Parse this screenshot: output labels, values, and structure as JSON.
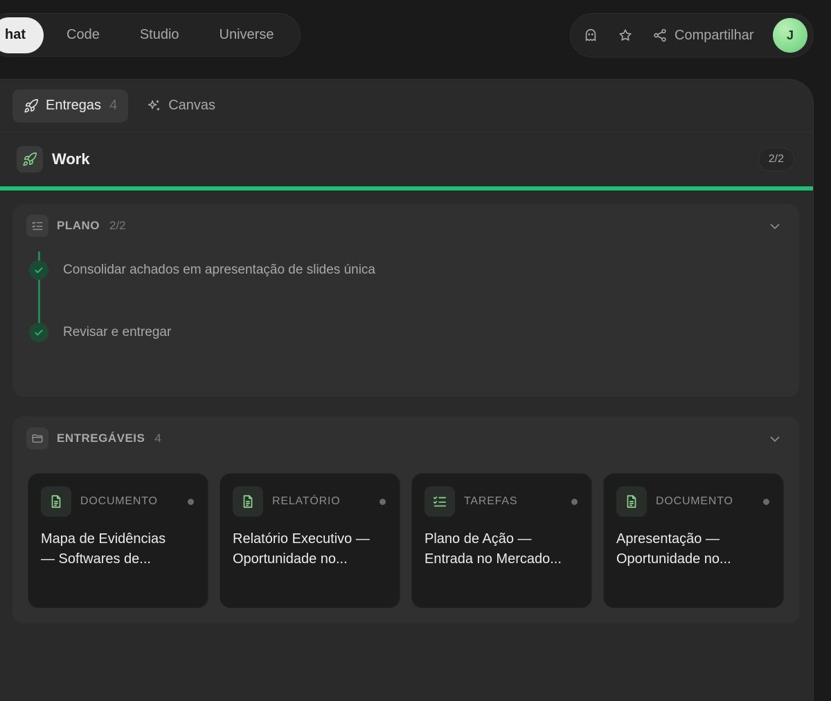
{
  "mode_tabs": [
    {
      "label": "hat",
      "active": true
    },
    {
      "label": "Code",
      "active": false
    },
    {
      "label": "Studio",
      "active": false
    },
    {
      "label": "Universe",
      "active": false
    }
  ],
  "top_actions": {
    "ghost_icon": "ghost-icon",
    "star_icon": "star-icon",
    "share_label": "Compartilhar",
    "avatar_initial": "J"
  },
  "panel_tabs": [
    {
      "label": "Entregas",
      "count": "4",
      "icon": "rocket-icon",
      "active": true
    },
    {
      "label": "Canvas",
      "count": "",
      "icon": "sparkles-icon",
      "active": false
    }
  ],
  "work": {
    "title": "Work",
    "count": "2/2",
    "progress": 1.0,
    "accent": "#22c073"
  },
  "plan": {
    "title": "PLANO",
    "count": "2/2",
    "steps": [
      {
        "text": "Consolidar achados em apresentação de slides única",
        "done": true
      },
      {
        "text": "Revisar e entregar",
        "done": true
      }
    ]
  },
  "deliverables": {
    "title": "ENTREGÁVEIS",
    "count": "4",
    "cards": [
      {
        "type": "DOCUMENTO",
        "icon": "document-icon",
        "title_line1": "Mapa de Evidências",
        "title_line2": "— Softwares de..."
      },
      {
        "type": "RELATÓRIO",
        "icon": "document-icon",
        "title_line1": "Relatório Executivo —",
        "title_line2": "Oportunidade no..."
      },
      {
        "type": "TAREFAS",
        "icon": "checklist-icon",
        "title_line1": "Plano de Ação —",
        "title_line2": "Entrada no Mercado..."
      },
      {
        "type": "DOCUMENTO",
        "icon": "document-icon",
        "title_line1": "Apresentação —",
        "title_line2": "Oportunidade no..."
      }
    ]
  }
}
